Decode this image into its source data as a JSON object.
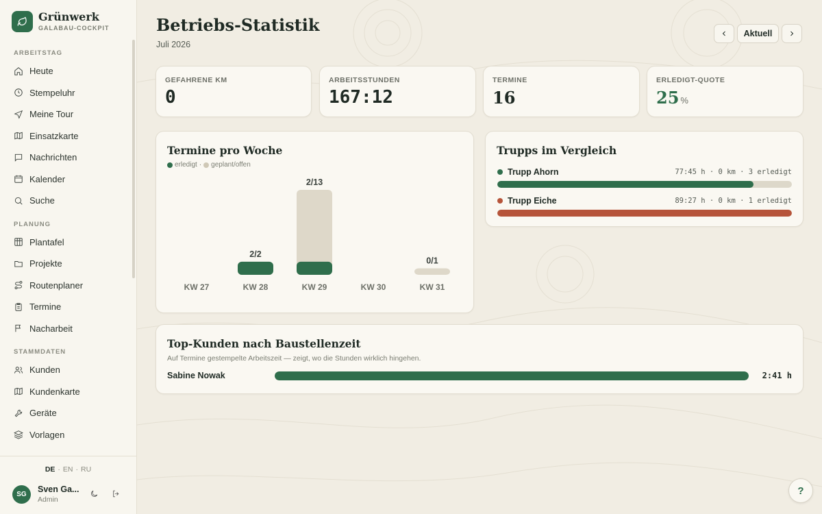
{
  "app": {
    "name": "Grünwerk",
    "subtitle": "GALABAU-COCKPIT"
  },
  "sidebar": {
    "sections": [
      {
        "label": "ARBEITSTAG",
        "items": [
          {
            "label": "Heute",
            "icon": "home-icon"
          },
          {
            "label": "Stempeluhr",
            "icon": "clock-icon"
          },
          {
            "label": "Meine Tour",
            "icon": "navigation-icon"
          },
          {
            "label": "Einsatzkarte",
            "icon": "map-icon"
          },
          {
            "label": "Nachrichten",
            "icon": "message-icon"
          },
          {
            "label": "Kalender",
            "icon": "calendar-icon"
          },
          {
            "label": "Suche",
            "icon": "search-icon"
          }
        ]
      },
      {
        "label": "PLANUNG",
        "items": [
          {
            "label": "Plantafel",
            "icon": "grid-icon"
          },
          {
            "label": "Projekte",
            "icon": "folder-icon"
          },
          {
            "label": "Routenplaner",
            "icon": "route-icon"
          },
          {
            "label": "Termine",
            "icon": "clipboard-icon"
          },
          {
            "label": "Nacharbeit",
            "icon": "flag-icon"
          }
        ]
      },
      {
        "label": "STAMMDATEN",
        "items": [
          {
            "label": "Kunden",
            "icon": "users-icon"
          },
          {
            "label": "Kundenkarte",
            "icon": "map-icon"
          },
          {
            "label": "Geräte",
            "icon": "wrench-icon"
          },
          {
            "label": "Vorlagen",
            "icon": "layers-icon"
          }
        ]
      }
    ],
    "languages": [
      "DE",
      "EN",
      "RU"
    ],
    "active_language": "DE",
    "user": {
      "initials": "SG",
      "name": "Sven Ga...",
      "role": "Admin"
    }
  },
  "header": {
    "title": "Betriebs-Statistik",
    "period": "Juli 2026",
    "today_label": "Aktuell"
  },
  "kpis": [
    {
      "label": "GEFAHRENE KM",
      "value": "0"
    },
    {
      "label": "ARBEITSSTUNDEN",
      "value": "167:12"
    },
    {
      "label": "TERMINE",
      "value": "16"
    },
    {
      "label": "ERLEDIGT-QUOTE",
      "value": "25",
      "unit": "%"
    }
  ],
  "weekly": {
    "title": "Termine pro Woche",
    "legend_done": "erledigt",
    "legend_separator": "·",
    "legend_planned": "geplant/offen"
  },
  "chart_data": {
    "type": "bar",
    "categories": [
      "KW 27",
      "KW 28",
      "KW 29",
      "KW 30",
      "KW 31"
    ],
    "series": [
      {
        "name": "erledigt",
        "values": [
          0,
          2,
          2,
          0,
          0
        ]
      },
      {
        "name": "geplant/offen",
        "values": [
          0,
          2,
          13,
          0,
          1
        ]
      }
    ],
    "data_labels": [
      "",
      "2/2",
      "2/13",
      "",
      "0/1"
    ],
    "colors": {
      "erledigt": "#2f6e4c",
      "geplant/offen": "#ded8c9"
    }
  },
  "trupps": {
    "title": "Trupps im Vergleich",
    "rows": [
      {
        "name": "Trupp Ahorn",
        "stats": "77:45 h · 0 km · 3 erledigt",
        "fraction": 0.87,
        "color": "#2f6e4c"
      },
      {
        "name": "Trupp Eiche",
        "stats": "89:27 h · 0 km · 1 erledigt",
        "fraction": 1.0,
        "color": "#b6543a"
      }
    ]
  },
  "kunden": {
    "title": "Top-Kunden nach Baustellenzeit",
    "subtitle": "Auf Termine gestempelte Arbeitszeit — zeigt, wo die Stunden wirklich hingehen.",
    "rows": [
      {
        "name": "Sabine Nowak",
        "time": "2:41 h",
        "fraction": 1.0
      }
    ]
  },
  "help_label": "?"
}
